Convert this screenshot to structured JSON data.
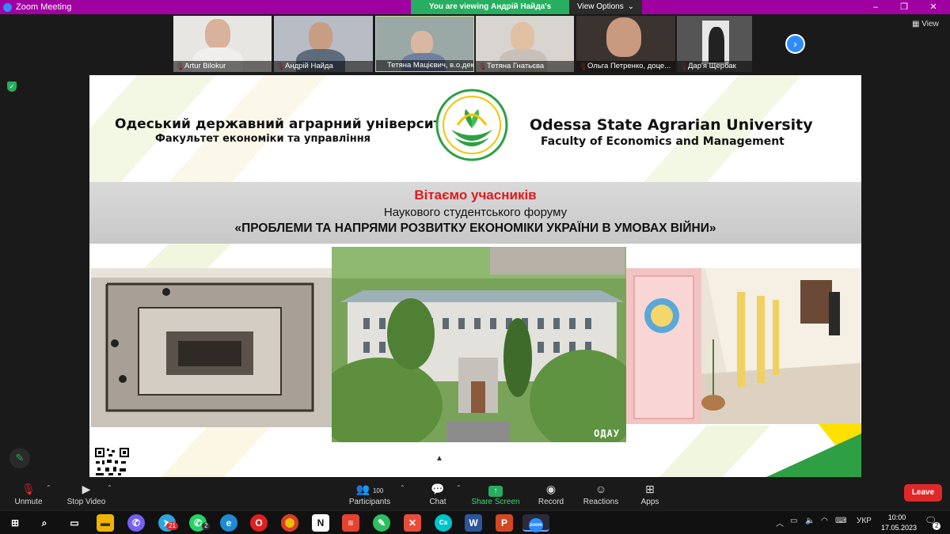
{
  "window": {
    "title": "Zoom Meeting",
    "banner_text": "You are viewing Андрій Найда's screen",
    "view_options_label": "View Options",
    "view_label": "View"
  },
  "participants": [
    {
      "name": "Artur Bilokur"
    },
    {
      "name": "Андрій Найда"
    },
    {
      "name": "Тетяна Мацієвич, в.о.дек..."
    },
    {
      "name": "Тетяна Гнатьєва"
    },
    {
      "name": "Ольга Петренко, доце..."
    },
    {
      "name": "Дар'я Щербак"
    }
  ],
  "slide": {
    "uk_title": "Одеський державний аграрний університет",
    "uk_subtitle": "Факультет економіки та управління",
    "en_title": "Odessa  State  Agrarian  University",
    "en_subtitle": "Faculty of Economics and Management",
    "welcome": "Вітаємо учасників",
    "forum_line": "Наукового студентського форуму",
    "forum_title": "«ПРОБЛЕМИ ТА НАПРЯМИ РОЗВИТКУ ЕКОНОМІКИ УКРАЇНИ В УМОВАХ ВІЙНИ»",
    "photo_tag": "ОДАУ"
  },
  "controls": {
    "unmute": "Unmute",
    "stop_video": "Stop Video",
    "participants": "Participants",
    "participants_count": "100",
    "chat": "Chat",
    "share_screen": "Share Screen",
    "record": "Record",
    "reactions": "Reactions",
    "apps": "Apps",
    "leave": "Leave"
  },
  "taskbar": {
    "badge_telegram": "21",
    "badge_whatsapp": "2",
    "language": "УКР",
    "time": "10:00",
    "date": "17.05.2023",
    "notification_count": "2"
  },
  "colors": {
    "title_bar": "#a000a0",
    "banner_green": "#27ae60",
    "welcome_red": "#e2191c",
    "leave_red": "#e02828",
    "zoom_blue": "#2d8cff"
  }
}
